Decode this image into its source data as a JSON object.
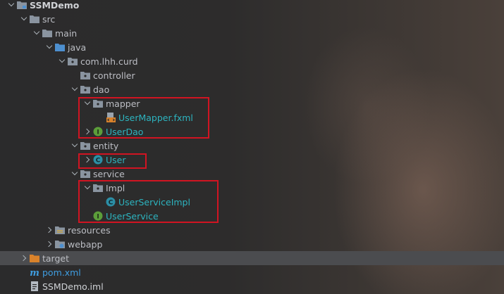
{
  "tree": {
    "project": "SSMDemo",
    "src": "src",
    "main": "main",
    "java": "java",
    "package": "com.lhh.curd",
    "controller": "controller",
    "dao": "dao",
    "mapper": "mapper",
    "user_mapper": "UserMapper.fxml",
    "user_dao": "UserDao",
    "entity": "entity",
    "user": "User",
    "service": "service",
    "impl": "Impl",
    "user_service_impl": "UserServiceImpl",
    "user_service": "UserService",
    "resources": "resources",
    "webapp": "webapp",
    "target": "target",
    "pom": "pom.xml",
    "iml": "SSMDemo.iml"
  },
  "class_icon_letter": "C",
  "interface_icon_letter": "I",
  "colors": {
    "class_icon": "#2c8fa6",
    "interface_icon": "#5c9e3a",
    "folder": "#8a94a0",
    "folder_blue": "#4d8fcf",
    "target_folder": "#d9822b",
    "highlight_box": "#d11422"
  }
}
